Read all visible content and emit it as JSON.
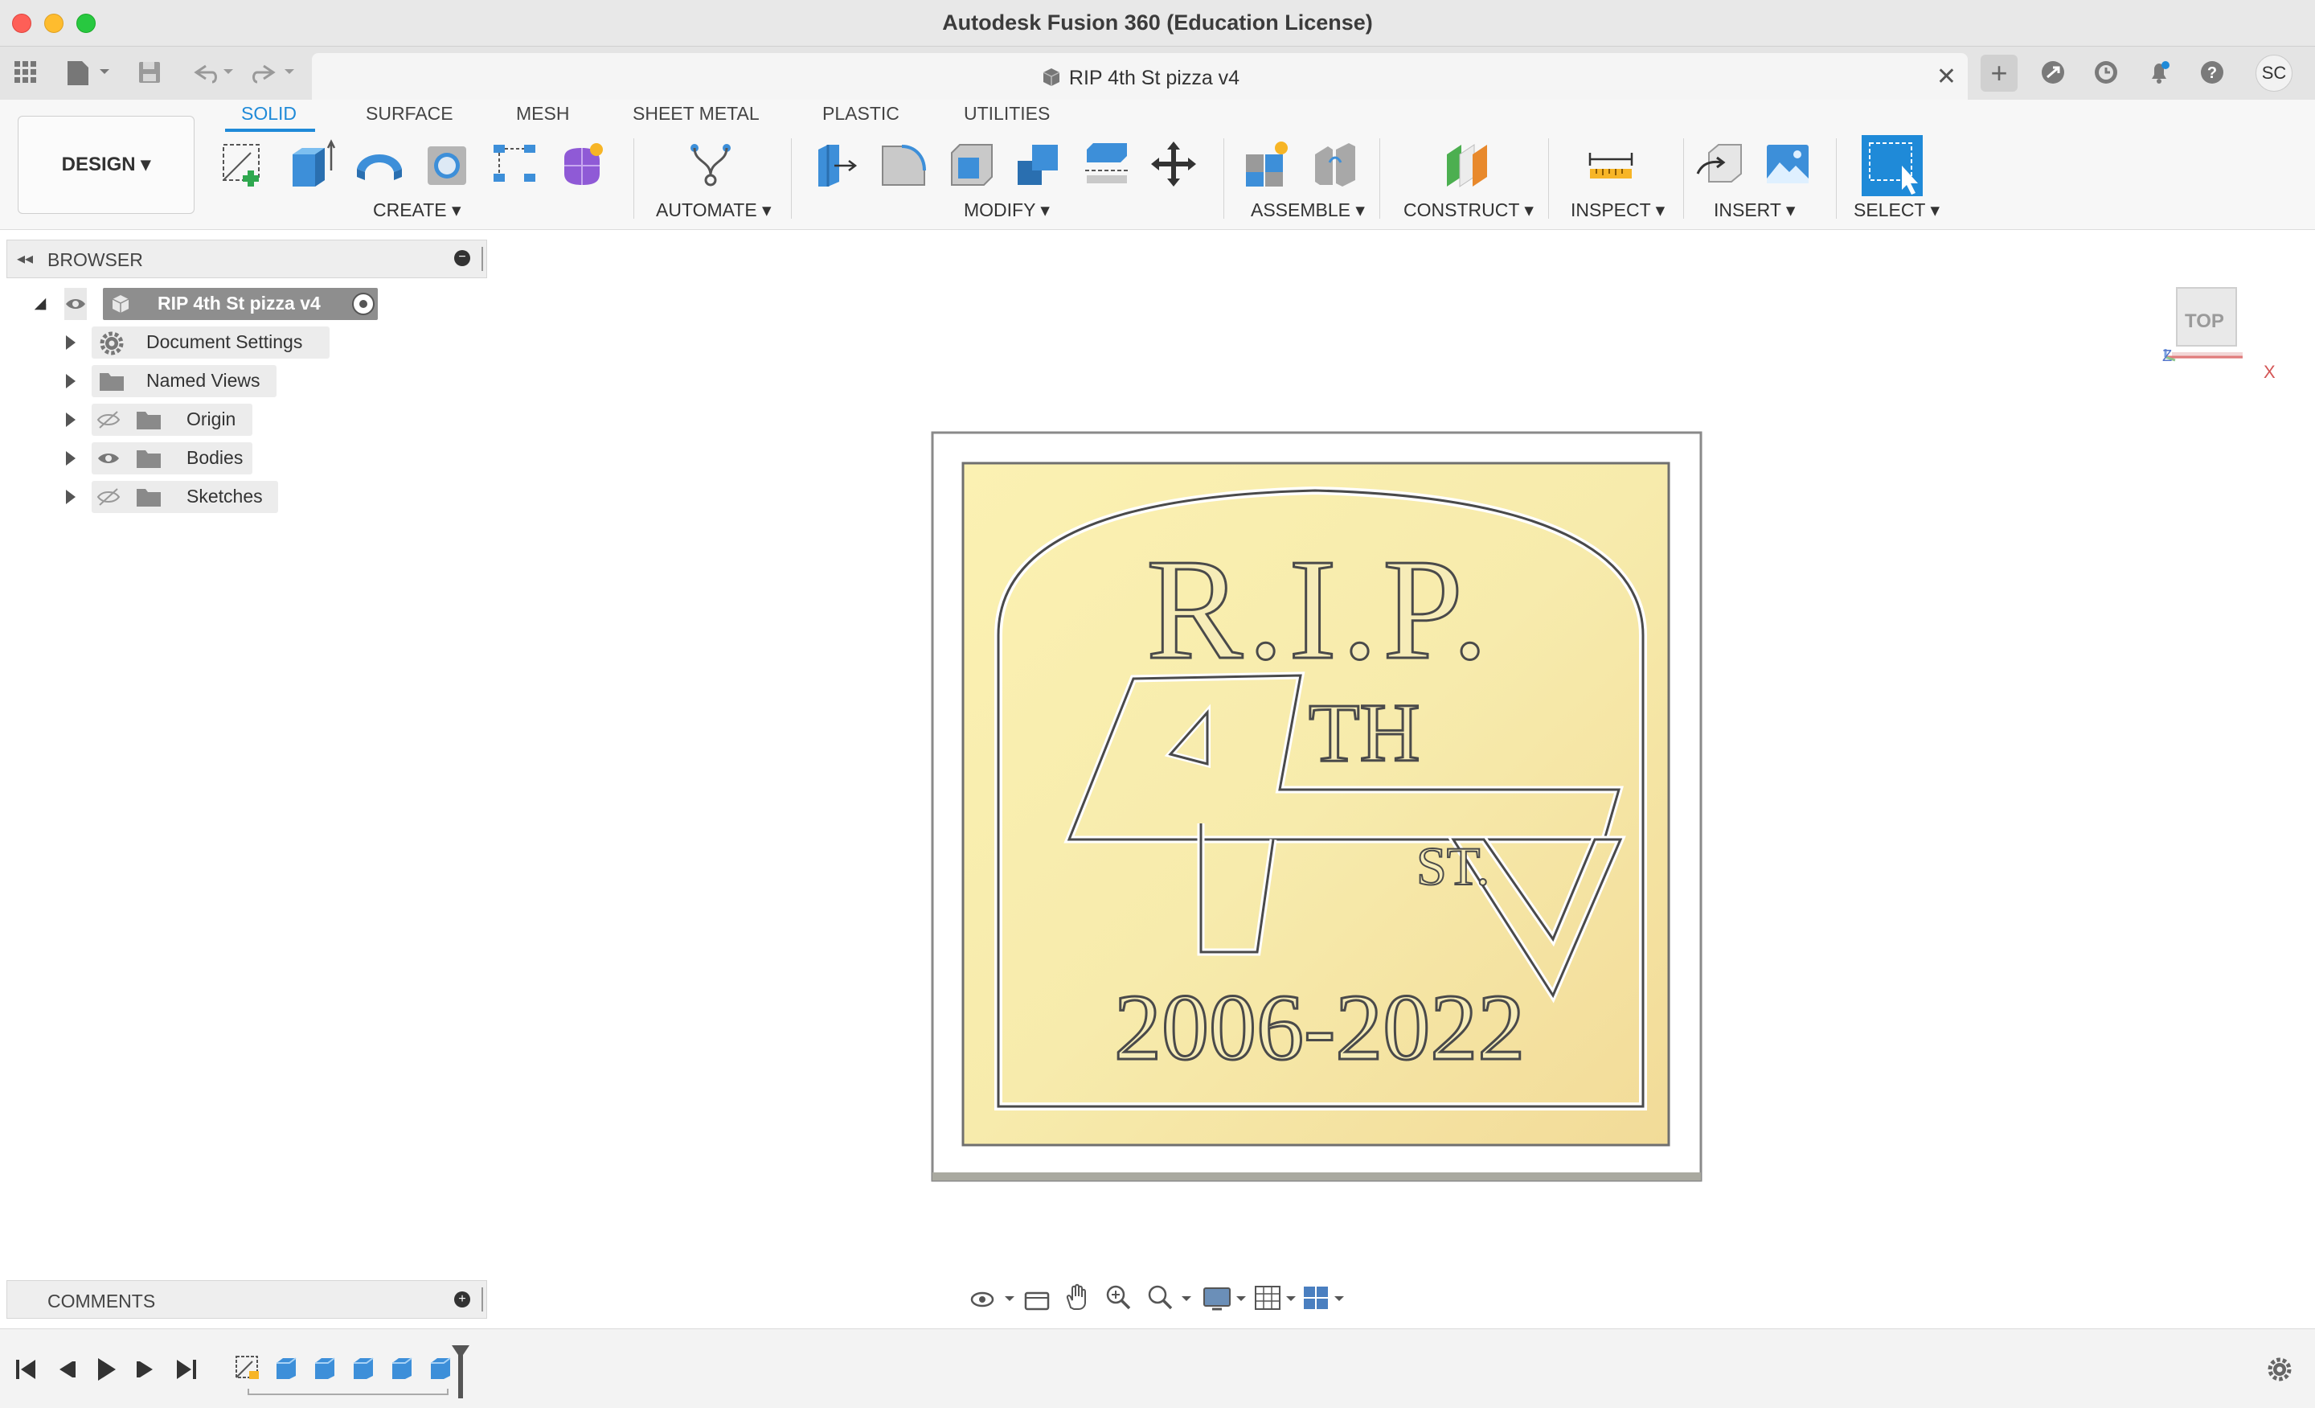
{
  "window": {
    "title": "Autodesk Fusion 360 (Education License)"
  },
  "document_tab": {
    "title": "RIP 4th St pizza v4"
  },
  "user": {
    "initials": "SC"
  },
  "workspace": {
    "label": "DESIGN ▾"
  },
  "toolbar_tabs": [
    {
      "label": "SOLID",
      "active": true
    },
    {
      "label": "SURFACE",
      "active": false
    },
    {
      "label": "MESH",
      "active": false
    },
    {
      "label": "SHEET METAL",
      "active": false
    },
    {
      "label": "PLASTIC",
      "active": false
    },
    {
      "label": "UTILITIES",
      "active": false
    }
  ],
  "tool_groups": {
    "create": "CREATE ▾",
    "automate": "AUTOMATE ▾",
    "modify": "MODIFY ▾",
    "assemble": "ASSEMBLE ▾",
    "construct": "CONSTRUCT ▾",
    "inspect": "INSPECT ▾",
    "insert": "INSERT ▾",
    "select": "SELECT ▾"
  },
  "browser": {
    "title": "BROWSER",
    "root": "RIP 4th St pizza v4",
    "items": [
      {
        "label": "Document Settings",
        "icon": "gear-icon",
        "visibility": "none"
      },
      {
        "label": "Named Views",
        "icon": "folder-icon",
        "visibility": "none"
      },
      {
        "label": "Origin",
        "icon": "folder-icon",
        "visibility": "hidden"
      },
      {
        "label": "Bodies",
        "icon": "folder-icon",
        "visibility": "visible"
      },
      {
        "label": "Sketches",
        "icon": "folder-icon",
        "visibility": "hidden"
      }
    ]
  },
  "viewcube": {
    "face": "TOP",
    "axis_x": "X",
    "axis_z": "Z"
  },
  "model": {
    "line1": "R.I.P.",
    "line2_superscript": "TH",
    "line2_number": "4",
    "line2_suffix": "ST.",
    "line3": "2006-2022"
  },
  "comments": {
    "title": "COMMENTS"
  },
  "colors": {
    "accent": "#1f8ad8",
    "plaque_gold": "#f5e6a3",
    "plaque_base": "#ffffff"
  }
}
